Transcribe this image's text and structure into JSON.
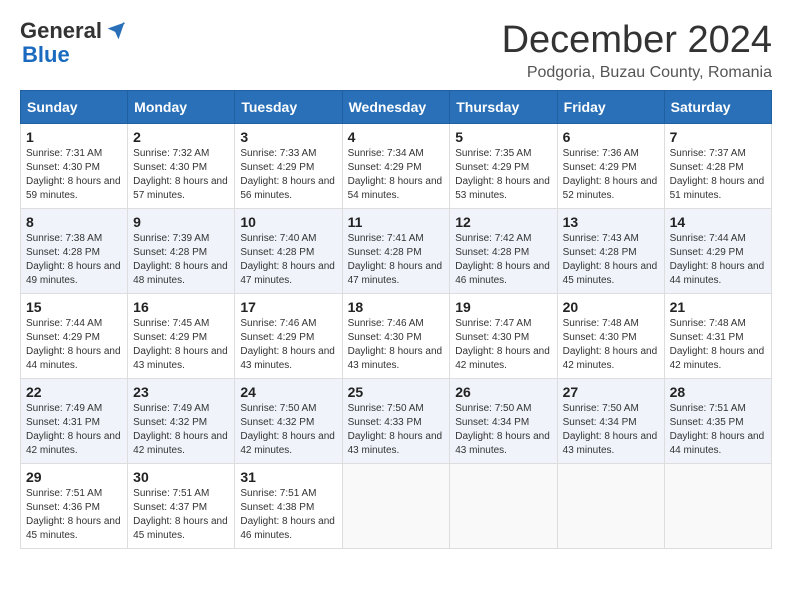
{
  "logo": {
    "general": "General",
    "blue": "Blue"
  },
  "header": {
    "month": "December 2024",
    "location": "Podgoria, Buzau County, Romania"
  },
  "weekdays": [
    "Sunday",
    "Monday",
    "Tuesday",
    "Wednesday",
    "Thursday",
    "Friday",
    "Saturday"
  ],
  "weeks": [
    [
      {
        "day": "1",
        "sunrise": "Sunrise: 7:31 AM",
        "sunset": "Sunset: 4:30 PM",
        "daylight": "Daylight: 8 hours and 59 minutes."
      },
      {
        "day": "2",
        "sunrise": "Sunrise: 7:32 AM",
        "sunset": "Sunset: 4:30 PM",
        "daylight": "Daylight: 8 hours and 57 minutes."
      },
      {
        "day": "3",
        "sunrise": "Sunrise: 7:33 AM",
        "sunset": "Sunset: 4:29 PM",
        "daylight": "Daylight: 8 hours and 56 minutes."
      },
      {
        "day": "4",
        "sunrise": "Sunrise: 7:34 AM",
        "sunset": "Sunset: 4:29 PM",
        "daylight": "Daylight: 8 hours and 54 minutes."
      },
      {
        "day": "5",
        "sunrise": "Sunrise: 7:35 AM",
        "sunset": "Sunset: 4:29 PM",
        "daylight": "Daylight: 8 hours and 53 minutes."
      },
      {
        "day": "6",
        "sunrise": "Sunrise: 7:36 AM",
        "sunset": "Sunset: 4:29 PM",
        "daylight": "Daylight: 8 hours and 52 minutes."
      },
      {
        "day": "7",
        "sunrise": "Sunrise: 7:37 AM",
        "sunset": "Sunset: 4:28 PM",
        "daylight": "Daylight: 8 hours and 51 minutes."
      }
    ],
    [
      {
        "day": "8",
        "sunrise": "Sunrise: 7:38 AM",
        "sunset": "Sunset: 4:28 PM",
        "daylight": "Daylight: 8 hours and 49 minutes."
      },
      {
        "day": "9",
        "sunrise": "Sunrise: 7:39 AM",
        "sunset": "Sunset: 4:28 PM",
        "daylight": "Daylight: 8 hours and 48 minutes."
      },
      {
        "day": "10",
        "sunrise": "Sunrise: 7:40 AM",
        "sunset": "Sunset: 4:28 PM",
        "daylight": "Daylight: 8 hours and 47 minutes."
      },
      {
        "day": "11",
        "sunrise": "Sunrise: 7:41 AM",
        "sunset": "Sunset: 4:28 PM",
        "daylight": "Daylight: 8 hours and 47 minutes."
      },
      {
        "day": "12",
        "sunrise": "Sunrise: 7:42 AM",
        "sunset": "Sunset: 4:28 PM",
        "daylight": "Daylight: 8 hours and 46 minutes."
      },
      {
        "day": "13",
        "sunrise": "Sunrise: 7:43 AM",
        "sunset": "Sunset: 4:28 PM",
        "daylight": "Daylight: 8 hours and 45 minutes."
      },
      {
        "day": "14",
        "sunrise": "Sunrise: 7:44 AM",
        "sunset": "Sunset: 4:29 PM",
        "daylight": "Daylight: 8 hours and 44 minutes."
      }
    ],
    [
      {
        "day": "15",
        "sunrise": "Sunrise: 7:44 AM",
        "sunset": "Sunset: 4:29 PM",
        "daylight": "Daylight: 8 hours and 44 minutes."
      },
      {
        "day": "16",
        "sunrise": "Sunrise: 7:45 AM",
        "sunset": "Sunset: 4:29 PM",
        "daylight": "Daylight: 8 hours and 43 minutes."
      },
      {
        "day": "17",
        "sunrise": "Sunrise: 7:46 AM",
        "sunset": "Sunset: 4:29 PM",
        "daylight": "Daylight: 8 hours and 43 minutes."
      },
      {
        "day": "18",
        "sunrise": "Sunrise: 7:46 AM",
        "sunset": "Sunset: 4:30 PM",
        "daylight": "Daylight: 8 hours and 43 minutes."
      },
      {
        "day": "19",
        "sunrise": "Sunrise: 7:47 AM",
        "sunset": "Sunset: 4:30 PM",
        "daylight": "Daylight: 8 hours and 42 minutes."
      },
      {
        "day": "20",
        "sunrise": "Sunrise: 7:48 AM",
        "sunset": "Sunset: 4:30 PM",
        "daylight": "Daylight: 8 hours and 42 minutes."
      },
      {
        "day": "21",
        "sunrise": "Sunrise: 7:48 AM",
        "sunset": "Sunset: 4:31 PM",
        "daylight": "Daylight: 8 hours and 42 minutes."
      }
    ],
    [
      {
        "day": "22",
        "sunrise": "Sunrise: 7:49 AM",
        "sunset": "Sunset: 4:31 PM",
        "daylight": "Daylight: 8 hours and 42 minutes."
      },
      {
        "day": "23",
        "sunrise": "Sunrise: 7:49 AM",
        "sunset": "Sunset: 4:32 PM",
        "daylight": "Daylight: 8 hours and 42 minutes."
      },
      {
        "day": "24",
        "sunrise": "Sunrise: 7:50 AM",
        "sunset": "Sunset: 4:32 PM",
        "daylight": "Daylight: 8 hours and 42 minutes."
      },
      {
        "day": "25",
        "sunrise": "Sunrise: 7:50 AM",
        "sunset": "Sunset: 4:33 PM",
        "daylight": "Daylight: 8 hours and 43 minutes."
      },
      {
        "day": "26",
        "sunrise": "Sunrise: 7:50 AM",
        "sunset": "Sunset: 4:34 PM",
        "daylight": "Daylight: 8 hours and 43 minutes."
      },
      {
        "day": "27",
        "sunrise": "Sunrise: 7:50 AM",
        "sunset": "Sunset: 4:34 PM",
        "daylight": "Daylight: 8 hours and 43 minutes."
      },
      {
        "day": "28",
        "sunrise": "Sunrise: 7:51 AM",
        "sunset": "Sunset: 4:35 PM",
        "daylight": "Daylight: 8 hours and 44 minutes."
      }
    ],
    [
      {
        "day": "29",
        "sunrise": "Sunrise: 7:51 AM",
        "sunset": "Sunset: 4:36 PM",
        "daylight": "Daylight: 8 hours and 45 minutes."
      },
      {
        "day": "30",
        "sunrise": "Sunrise: 7:51 AM",
        "sunset": "Sunset: 4:37 PM",
        "daylight": "Daylight: 8 hours and 45 minutes."
      },
      {
        "day": "31",
        "sunrise": "Sunrise: 7:51 AM",
        "sunset": "Sunset: 4:38 PM",
        "daylight": "Daylight: 8 hours and 46 minutes."
      },
      null,
      null,
      null,
      null
    ]
  ]
}
